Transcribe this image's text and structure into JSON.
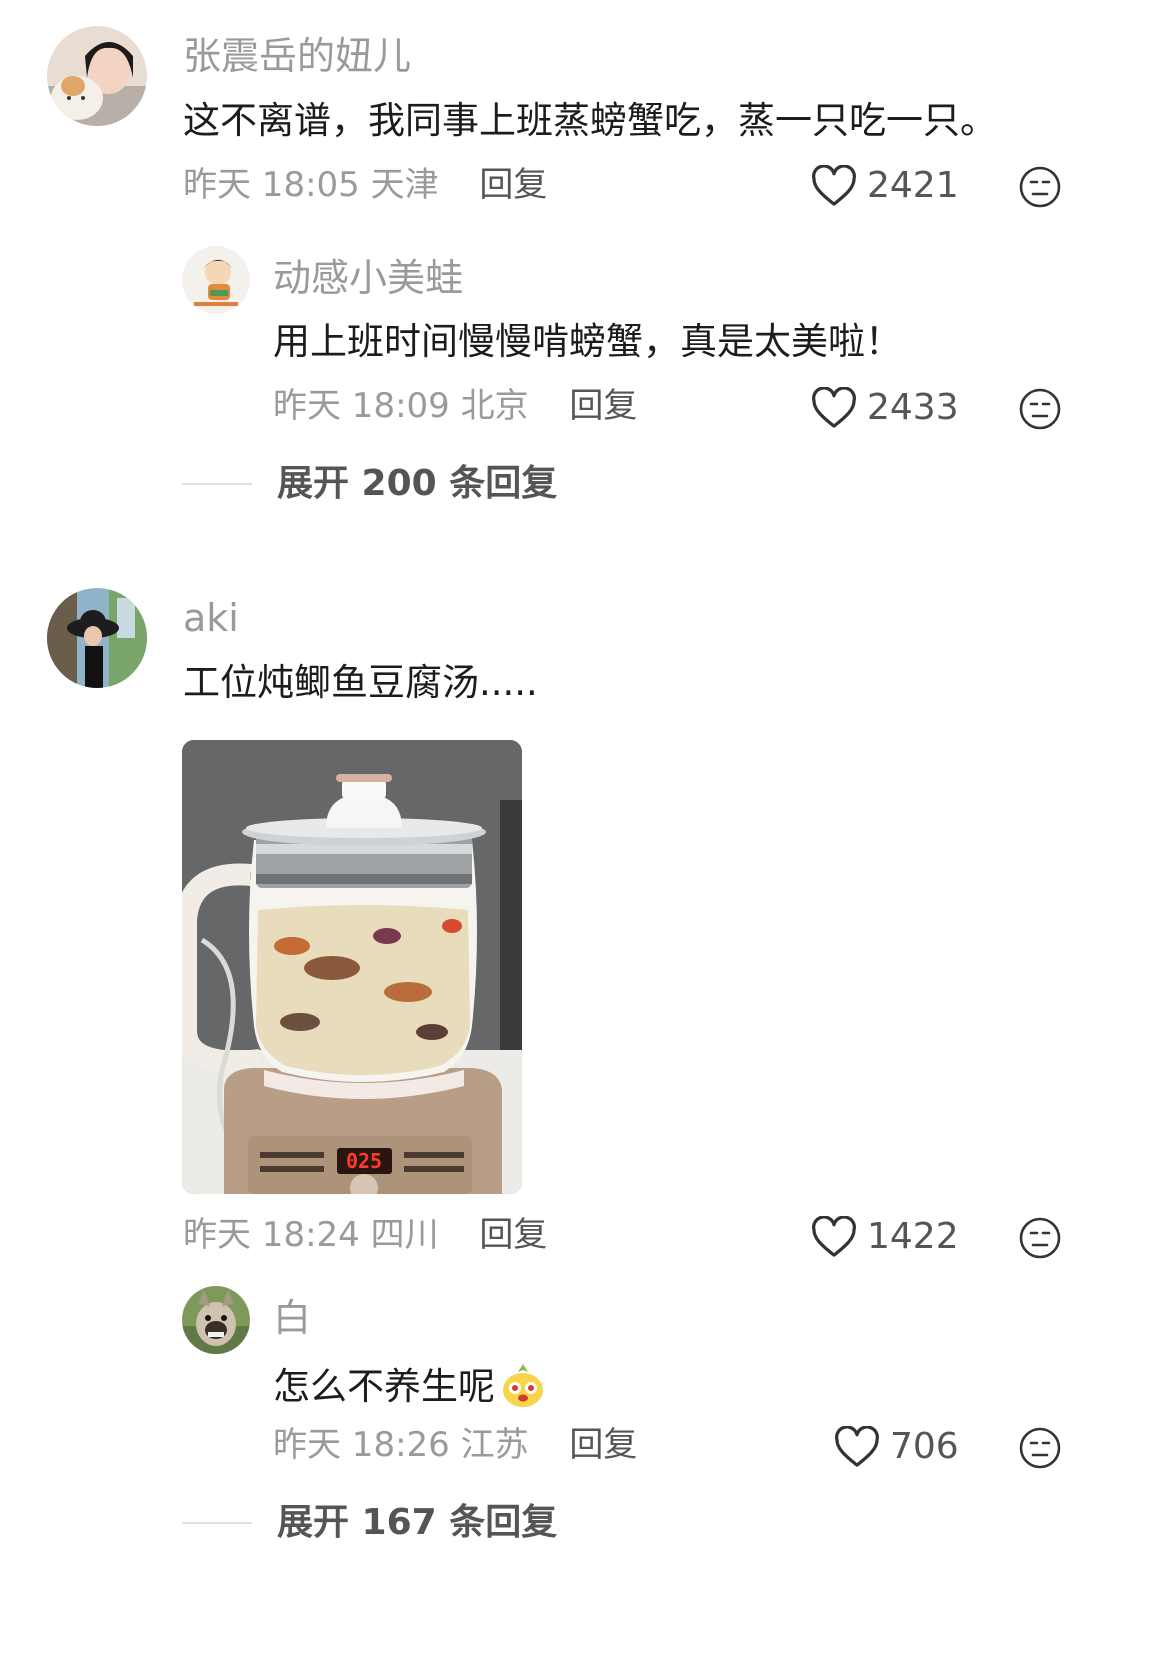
{
  "comments": [
    {
      "username": "张震岳的妞儿",
      "text": "这不离谱，我同事上班蒸螃蟹吃，蒸一只吃一只。",
      "time": "昨天 18:05",
      "location": "天津",
      "reply_label": "回复",
      "likes": "2421",
      "replies": [
        {
          "username": "动感小美蛙",
          "text": "用上班时间慢慢啃螃蟹，真是太美啦！",
          "time": "昨天 18:09",
          "location": "北京",
          "reply_label": "回复",
          "likes": "2433"
        }
      ],
      "expand_label": "展开 200 条回复"
    },
    {
      "username": "aki",
      "text": "工位炖鲫鱼豆腐汤.....",
      "time": "昨天 18:24",
      "location": "四川",
      "reply_label": "回复",
      "likes": "1422",
      "cooker_display": "025",
      "replies": [
        {
          "username": "白",
          "text": "怎么不养生呢",
          "time": "昨天 18:26",
          "location": "江苏",
          "reply_label": "回复",
          "likes": "706"
        }
      ],
      "expand_label": "展开 167 条回复"
    }
  ],
  "colors": {
    "username": "#9a9a9a",
    "text": "#1c1c1c",
    "meta": "#9a9a9a",
    "action": "#555555"
  },
  "icons": {
    "like": "heart-outline-icon",
    "dislike": "neutral-face-icon",
    "emoji": "yellow-face-emoji"
  }
}
